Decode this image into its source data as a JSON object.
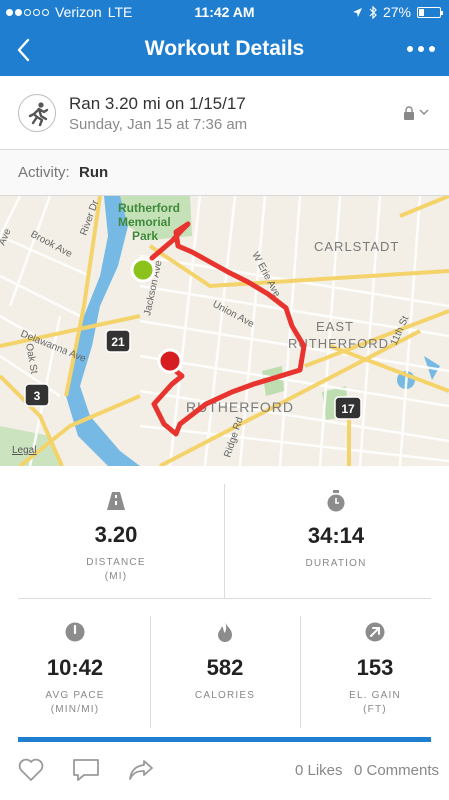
{
  "status_bar": {
    "carrier": "Verizon",
    "network": "LTE",
    "time": "11:42 AM",
    "battery": "27%",
    "battery_level": 0.27,
    "signal_bars": 2
  },
  "nav": {
    "title": "Workout Details"
  },
  "workout": {
    "title": "Ran 3.20 mi on 1/15/17",
    "subtitle": "Sunday, Jan 15 at 7:36 am",
    "activity_label": "Activity:",
    "activity_value": "Run"
  },
  "map": {
    "labels": {
      "park_line1": "Rutherford",
      "park_line2": "Memorial",
      "park_line3": "Park",
      "carlstadt": "CARLSTADT",
      "east": "EAST",
      "east_rutherford": "RUTHERFORD",
      "rutherford": "RUTHERFORD",
      "brook": "Brook Ave",
      "river": "River Dr",
      "jackson": "Jackson Ave",
      "erie": "W Erie Ave",
      "union": "Union Ave",
      "delawanna": "Delawanna Ave",
      "oak": "Oak St",
      "ridge": "Ridge Rd",
      "eleventh": "11th St",
      "ave": "Ave",
      "legal": "Legal",
      "route21": "21",
      "route3": "3",
      "route17": "17"
    },
    "colors": {
      "route": "#e8342f",
      "start": "#8cc21c",
      "end": "#d61d20",
      "water": "#76b9e4",
      "park": "#a6d79a"
    }
  },
  "stats": {
    "distance": {
      "value": "3.20",
      "label": "DISTANCE",
      "unit": "(MI)"
    },
    "duration": {
      "value": "34:14",
      "label": "DURATION"
    },
    "avg_pace": {
      "value": "10:42",
      "label": "AVG PACE",
      "unit": "(MIN/MI)"
    },
    "calories": {
      "value": "582",
      "label": "CALORIES"
    },
    "elevation": {
      "value": "153",
      "label": "EL. GAIN",
      "unit": "(FT)"
    }
  },
  "social": {
    "likes": "0 Likes",
    "comments": "0 Comments"
  },
  "theme": {
    "accent": "#1f7ed0",
    "icon_gray": "#8c8c8c"
  }
}
